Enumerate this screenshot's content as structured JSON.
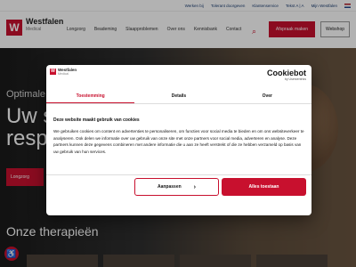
{
  "topbar": {
    "links": [
      "Werken bij",
      "Tolerant doorgeven",
      "Klantenservice",
      "Tekst A | A",
      "Mijn Westfalen"
    ]
  },
  "header": {
    "logo_mark": "W",
    "brand": "Westfalen",
    "brand_sub": "Medical",
    "nav": [
      "Longzorg",
      "Beademing",
      "Slaapproblemen",
      "Over ons",
      "Kennisbank",
      "Contact"
    ],
    "search_icon": "search-icon",
    "appointment": "Afspraak maken",
    "webshop": "Webshop"
  },
  "hero": {
    "eyebrow": "Optimale",
    "title_line1": "Uw s",
    "title_line2": "respi",
    "button": "Longzorg",
    "therapies_heading": "Onze therapieën"
  },
  "a11y": {
    "icon": "accessibility-icon",
    "glyph": "♿"
  },
  "consent": {
    "logo_mark": "W",
    "brand": "Westfalen",
    "brand_sub": "Medical",
    "provider": "Cookiebot",
    "provider_sub": "by Usercentrics",
    "tabs": [
      "Toestemming",
      "Details",
      "Over"
    ],
    "active_tab": 0,
    "heading": "Deze website maakt gebruik van cookies",
    "body": "We gebruiken cookies om content en advertenties te personaliseren, om functies voor social media te bieden en om ons websiteverkeer te analyseren. Ook delen we informatie over uw gebruik van onze site met onze partners voor social media, adverteren en analyse. Deze partners kunnen deze gegevens combineren met andere informatie die u aan ze heeft verstrekt of die ze hebben verzameld op basis van uw gebruik van hun services.",
    "customize_button": "Aanpassen",
    "allow_all_button": "Alles toestaan"
  },
  "colors": {
    "brand_red": "#c8102e",
    "navy": "#1d3f73"
  }
}
